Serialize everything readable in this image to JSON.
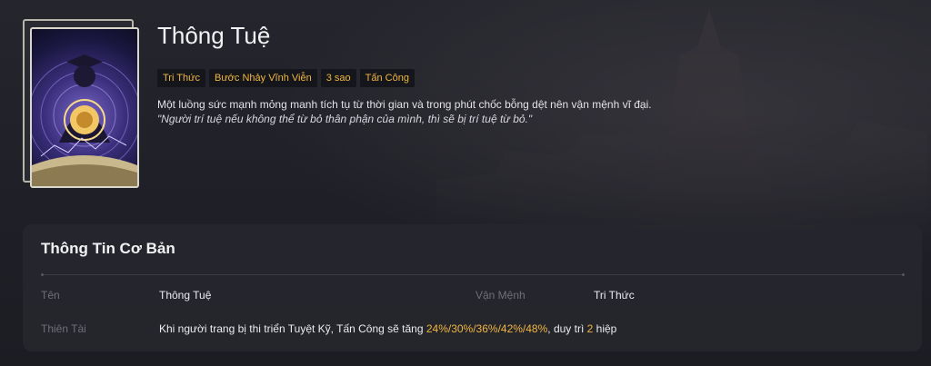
{
  "hero": {
    "name": "Thông Tuệ",
    "tags": [
      "Tri Thức",
      "Bước Nhảy Vĩnh Viễn",
      "3 sao",
      "Tấn Công"
    ],
    "description": "Một luồng sức mạnh mỏng manh tích tụ từ thời gian và trong phút chốc bỗng dệt nên vận mệnh vĩ đại.",
    "quote": "\"Người trí tuệ nếu không thể từ bỏ thân phận của mình, thì sẽ bị trí tuệ từ bỏ.\""
  },
  "basic_info": {
    "title": "Thông Tin Cơ Bản",
    "name_label": "Tên",
    "name_value": "Thông Tuệ",
    "fate_label": "Vận Mệnh",
    "fate_value": "Tri Thức",
    "talent_label": "Thiên Tài",
    "talent_prefix": "Khi người trang bị thi triển Tuyệt Kỹ, Tấn Công sẽ tăng ",
    "talent_values": "24%/30%/36%/42%/48%",
    "talent_middle": ", duy trì ",
    "talent_turns": "2",
    "talent_suffix": " hiệp"
  },
  "colors": {
    "accent": "#f0b63f",
    "background": "#1e2027",
    "panel": "#26272e"
  }
}
